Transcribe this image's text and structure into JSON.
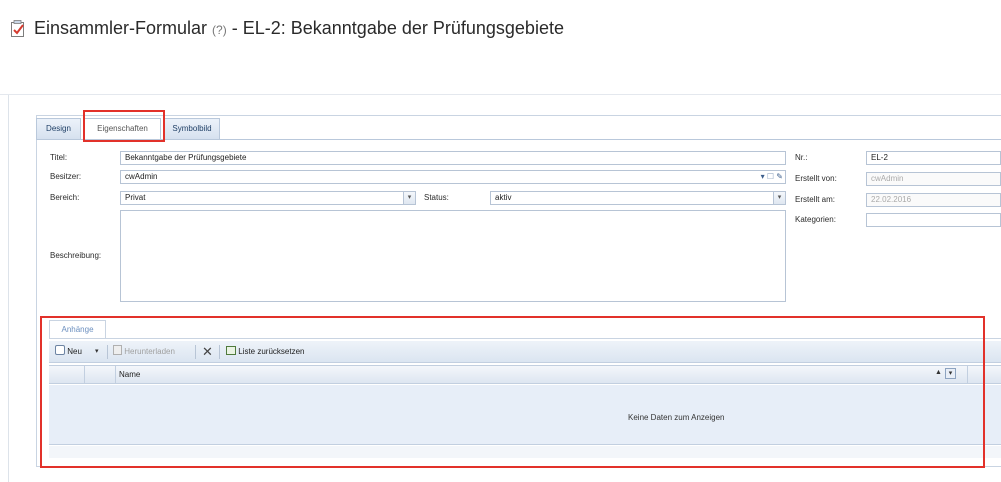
{
  "window": {
    "title_main": "Einsammler-Formular",
    "title_help": "(?)",
    "title_rest": "- EL-2: Bekanntgabe der Prüfungsgebiete",
    "icon": "form-check-icon"
  },
  "tabs": [
    {
      "label": "Design"
    },
    {
      "label": "Eigenschaften"
    },
    {
      "label": "Symbolbild"
    }
  ],
  "form": {
    "title_label": "Titel:",
    "title_value": "Bekanntgabe der Prüfungsgebiete",
    "owner_label": "Besitzer:",
    "owner_value": "cwAdmin",
    "area_label": "Bereich:",
    "area_value": "Privat",
    "status_label": "Status:",
    "status_value": "aktiv",
    "description_label": "Beschreibung:",
    "nr_label": "Nr.:",
    "nr_value": "EL-2",
    "created_by_label": "Erstellt von:",
    "created_by_value": "cwAdmin",
    "created_on_label": "Erstellt am:",
    "created_on_value": "22.02.2016",
    "categories_label": "Kategorien:",
    "categories_value": ""
  },
  "attachments": {
    "tab_label": "Anhänge",
    "toolbar": {
      "new_label": "Neu",
      "download_label": "Herunterladen",
      "reset_label": "Liste zurücksetzen"
    },
    "column_name": "Name",
    "empty_text": "Keine Daten zum Anzeigen"
  },
  "colors": {
    "highlight": "#e2312a",
    "accent": "#1f3f66"
  }
}
